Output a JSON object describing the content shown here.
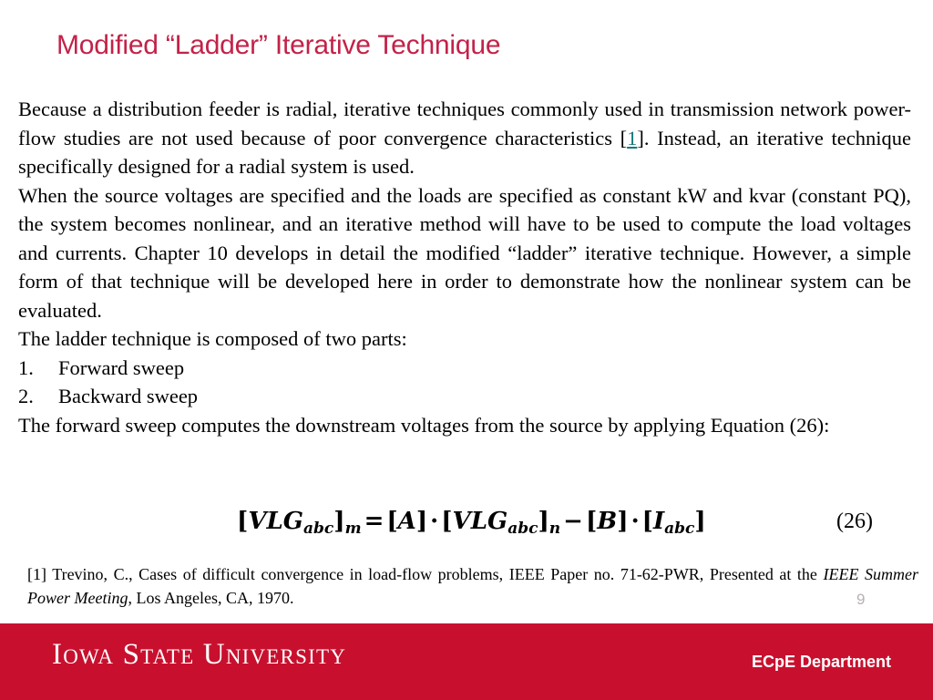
{
  "slide": {
    "title": "Modified “Ladder” Iterative Technique",
    "title_color": "#C32248",
    "page_number": "9"
  },
  "body": {
    "paragraph_1_part_a": "Because a distribution feeder is radial, iterative techniques commonly used in transmission network power-flow studies are not used because of poor convergence characteristics [",
    "paragraph_1_link": "1",
    "paragraph_1_part_b": "]. Instead, an iterative technique specifically designed for a radial system is used.",
    "paragraph_2": "When the source voltages are specified and the loads are specified as constant kW and kvar (constant PQ), the system becomes nonlinear, and an iterative method will have to be used to compute the load voltages and currents. Chapter 10 develops in detail the modified “ladder” iterative technique. However, a simple form of that technique will be developed here in order to demonstrate how the nonlinear system can be evaluated.",
    "paragraph_3": "The ladder technique is composed of two parts:",
    "list_items": [
      {
        "marker": "1.",
        "label": "Forward sweep"
      },
      {
        "marker": "2.",
        "label": "Backward sweep"
      }
    ],
    "paragraph_4": "The forward sweep computes the downstream voltages from the source by applying Equation (26):"
  },
  "equation": {
    "lhs_open": "[",
    "lhs_var": "VLG",
    "lhs_sub": "abc",
    "lhs_close": "]",
    "lhs_index": "m",
    "equals": "=",
    "a_open": "[",
    "a_var": "A",
    "a_close": "]",
    "dot1": "·",
    "rhs_open": "[",
    "rhs_var": "VLG",
    "rhs_sub": "abc",
    "rhs_close": "]",
    "rhs_index": "n",
    "minus": "−",
    "b_open": "[",
    "b_var": "B",
    "b_close": "]",
    "dot2": "·",
    "i_open": "[",
    "i_var": "I",
    "i_sub": "abc",
    "i_close": "]",
    "number": "(26)",
    "plain_text": "[VLG_abc]_m = [A] · [VLG_abc]_n − [B] · [I_abc]"
  },
  "reference": {
    "prefix": "[1] Trevino, C., Cases of difficult convergence in load-flow problems, IEEE Paper no. 71-62-PWR, Presented at the ",
    "italic_title": "IEEE Summer Power Meeting",
    "suffix": ", Los Angeles, CA, 1970."
  },
  "footer": {
    "wordmark": "Iowa State University",
    "department": "ECpE Department",
    "bar_color": "#C8102E"
  }
}
